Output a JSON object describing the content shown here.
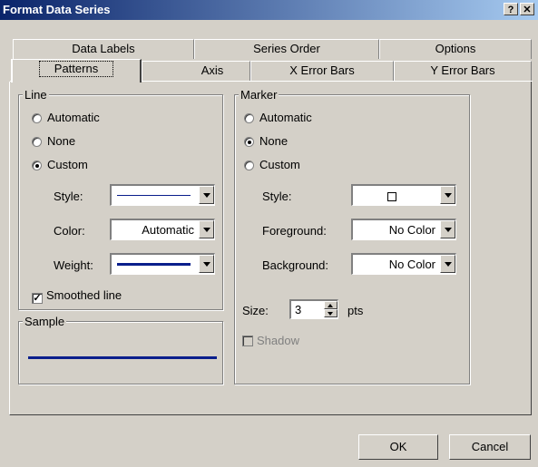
{
  "window": {
    "title": "Format Data Series",
    "help_label": "?",
    "close_label": "✕"
  },
  "tabs_back": [
    "Data Labels",
    "Series Order",
    "Options"
  ],
  "tabs_front": [
    "Patterns",
    "Axis",
    "X Error Bars",
    "Y Error Bars"
  ],
  "active_tab": "Patterns",
  "line": {
    "legend": "Line",
    "options": [
      "Automatic",
      "None",
      "Custom"
    ],
    "selected": "Custom",
    "style_label": "Style:",
    "color_label": "Color:",
    "color_value": "Automatic",
    "weight_label": "Weight:",
    "smoothed_label": "Smoothed line",
    "smoothed_checked": true,
    "line_color": "#0a1e8c"
  },
  "sample": {
    "legend": "Sample"
  },
  "marker": {
    "legend": "Marker",
    "options": [
      "Automatic",
      "None",
      "Custom"
    ],
    "selected": "None",
    "style_label": "Style:",
    "foreground_label": "Foreground:",
    "foreground_value": "No Color",
    "background_label": "Background:",
    "background_value": "No Color",
    "size_label": "Size:",
    "size_value": "3",
    "size_unit": "pts",
    "shadow_label": "Shadow"
  },
  "buttons": {
    "ok": "OK",
    "cancel": "Cancel"
  }
}
